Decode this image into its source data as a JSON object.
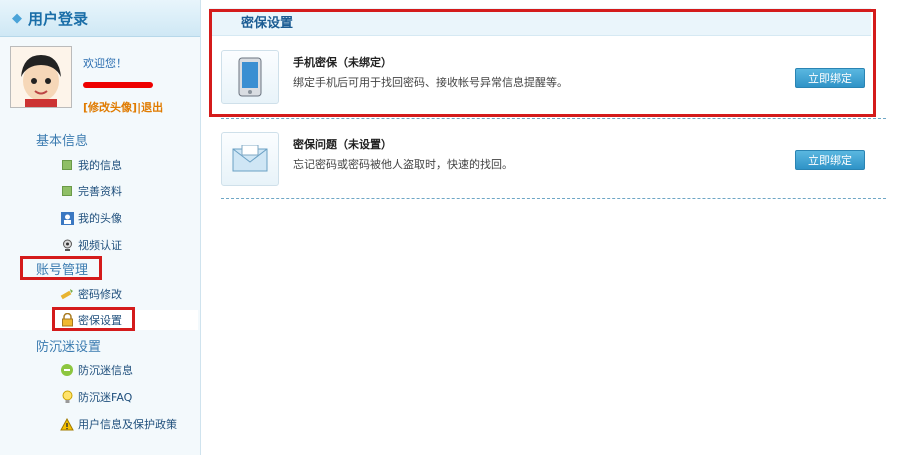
{
  "sidebar": {
    "header": "用户登录",
    "welcome": "欢迎您！",
    "username": "",
    "edit_avatar": "[修改头像]",
    "logout_suffix": "|退出",
    "sections": {
      "basic": "基本信息",
      "account": "账号管理",
      "anti_addiction": "防沉迷设置"
    },
    "items": {
      "my_info": "我的信息",
      "complete_info": "完善资料",
      "my_avatar": "我的头像",
      "video_verify": "视频认证",
      "password_change": "密码修改",
      "security_settings": "密保设置",
      "anti_info": "防沉迷信息",
      "anti_faq": "防沉迷FAQ",
      "privacy_policy": "用户信息及保护政策"
    }
  },
  "main": {
    "title": "密保设置",
    "phone": {
      "title": "手机密保（未绑定）",
      "desc": "绑定手机后可用于找回密码、接收帐号异常信息提醒等。",
      "button": "立即绑定"
    },
    "question": {
      "title": "密保问题（未设置）",
      "desc": "忘记密码或密码被他人盗取时，快速的找回。",
      "button": "立即绑定"
    }
  },
  "colors": {
    "accent": "#2f93c7",
    "highlight": "#d41b1b",
    "sidebar_bg": "#f3f9fc"
  },
  "icons": [
    "diamond-icon",
    "avatar-icon",
    "bullet-icon",
    "avatar-small-icon",
    "webcam-icon",
    "key-pencil-icon",
    "lock-icon",
    "game-icon",
    "bulb-icon",
    "warning-icon",
    "phone-icon",
    "mail-icon"
  ]
}
